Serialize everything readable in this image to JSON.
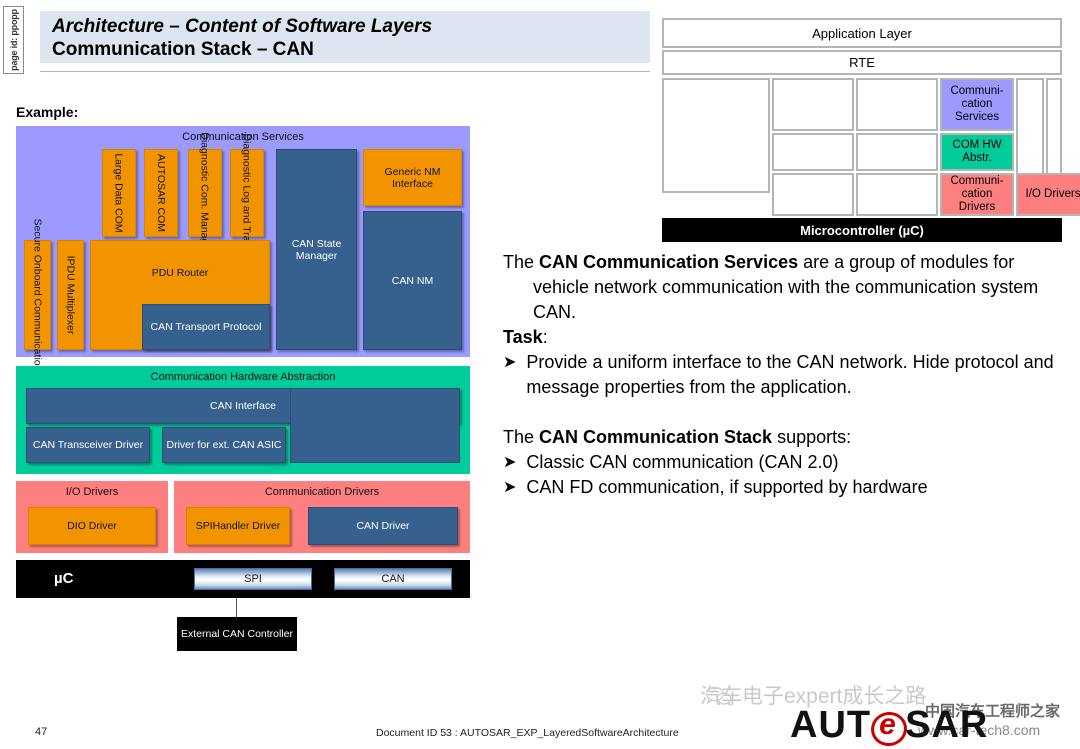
{
  "page_tab": {
    "label": "page id: ppopp"
  },
  "title": {
    "line1": "Architecture – Content of Software Layers",
    "line2": "Communication Stack – CAN"
  },
  "example_label": "Example:",
  "diagram": {
    "layers": {
      "communication_services": "Communication Services",
      "communication_hw_abstraction": "Communication Hardware Abstraction",
      "io_drivers": "I/O Drivers",
      "communication_drivers": "Communication Drivers",
      "microcontroller": "µC"
    },
    "services_modules": [
      {
        "name": "secure-onboard-communication",
        "label": "Secure Onboard Communication",
        "color": "orange",
        "orientation": "vertical"
      },
      {
        "name": "ipdu-multiplexer",
        "label": "IPDU Multiplexer",
        "color": "orange",
        "orientation": "vertical"
      },
      {
        "name": "large-data-com",
        "label": "Large Data COM",
        "color": "orange",
        "orientation": "vertical"
      },
      {
        "name": "autosar-com",
        "label": "AUTOSAR COM",
        "color": "orange",
        "orientation": "vertical"
      },
      {
        "name": "diagnostic-com-manager",
        "label": "Diagnostic Com. Manager",
        "color": "orange",
        "orientation": "vertical"
      },
      {
        "name": "diagnostic-log-and-trace",
        "label": "Diagnostic Log and Trace",
        "color": "orange",
        "orientation": "vertical"
      },
      {
        "name": "pdu-router",
        "label": "PDU Router",
        "color": "orange",
        "orientation": "horizontal"
      },
      {
        "name": "can-transport-protocol",
        "label": "CAN Transport Protocol",
        "color": "blue",
        "orientation": "horizontal"
      },
      {
        "name": "can-state-manager",
        "label": "CAN State Manager",
        "color": "blue",
        "orientation": "horizontal"
      },
      {
        "name": "generic-nm-interface",
        "label": "Generic NM Interface",
        "color": "orange",
        "orientation": "horizontal"
      },
      {
        "name": "can-nm",
        "label": "CAN NM",
        "color": "blue",
        "orientation": "horizontal"
      }
    ],
    "hw_abstraction_modules": [
      {
        "name": "can-interface",
        "label": "CAN Interface",
        "color": "blue"
      },
      {
        "name": "can-transceiver-driver",
        "label": "CAN Transceiver Driver",
        "color": "blue"
      },
      {
        "name": "driver-for-ext-can-asic",
        "label": "Driver for ext. CAN ASIC",
        "color": "blue"
      }
    ],
    "io_driver_modules": [
      {
        "name": "dio-driver",
        "label": "DIO Driver",
        "color": "orange"
      }
    ],
    "comm_driver_modules": [
      {
        "name": "spihandler-driver",
        "label": "SPIHandler Driver",
        "color": "orange"
      },
      {
        "name": "can-driver",
        "label": "CAN Driver",
        "color": "blue"
      }
    ],
    "uc_peripherals": [
      {
        "name": "spi-peripheral",
        "label": "SPI"
      },
      {
        "name": "can-peripheral",
        "label": "CAN"
      }
    ],
    "external_can_controller": "External CAN Controller"
  },
  "mini_architecture": {
    "application_layer": "Application Layer",
    "rte": "RTE",
    "microcontroller": "Microcontroller (µC)",
    "highlighted": {
      "communication_services": "Communi-cation Services",
      "com_hw_abstr": "COM HW Abstr.",
      "communication_drivers": "Communi-cation Drivers",
      "io_drivers": "I/O Drivers"
    }
  },
  "body": {
    "intro_prefix": "The ",
    "intro_bold": "CAN Communication Services",
    "intro_suffix": " are a group of modules for vehicle network communication with the communication system CAN.",
    "task_label": "Task",
    "task_colon": ":",
    "task_bullet": "Provide a uniform interface to the CAN network. Hide protocol and message properties from the application.",
    "stack_prefix": "The ",
    "stack_bold": "CAN Communication Stack",
    "stack_suffix": " supports:",
    "stack_bullets": [
      "Classic CAN communication (CAN 2.0)",
      "CAN FD communication, if supported by hardware"
    ],
    "bullet_glyph": "➤"
  },
  "footer": {
    "page_number": "47",
    "document_id": "Document ID 53 : AUTOSAR_EXP_LayeredSoftwareArchitecture"
  },
  "watermarks": {
    "wechat_text": "汽车电子expert成长之路",
    "chinese_site": "中国汽车工程师之家",
    "chinese_url": "www.car-tech8.com",
    "autosar_logo_left": "AUT",
    "autosar_logo_right": "SAR"
  },
  "colors": {
    "services_purple": "#9a9aff",
    "hw_abstr_green": "#00cc99",
    "drivers_red": "#fd7f7f",
    "module_orange": "#f29400",
    "module_blue": "#36618e",
    "title_band": "#dde5f0",
    "mcu_black": "#000000"
  }
}
